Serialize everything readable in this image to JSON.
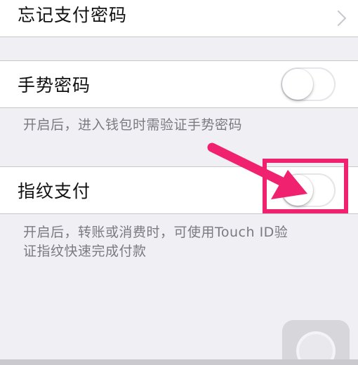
{
  "settings": {
    "forgot_password": {
      "label": "忘记支付密码"
    },
    "gesture_password": {
      "label": "手势密码",
      "enabled": false,
      "description": "开启后，进入钱包时需验证手势密码"
    },
    "fingerprint_pay": {
      "label": "指纹支付",
      "enabled": false,
      "description_line1": "开启后，转账或消费时，可使用Touch ID验",
      "description_line2": "证指纹快速完成付款"
    }
  },
  "colors": {
    "background": "#efeff4",
    "row": "#ffffff",
    "highlight": "#f0226f",
    "note_text": "#7a7a80"
  },
  "icons": {
    "chevron": "chevron-right-icon",
    "arrow": "annotation-arrow-icon",
    "assistive": "assistive-touch-icon"
  }
}
